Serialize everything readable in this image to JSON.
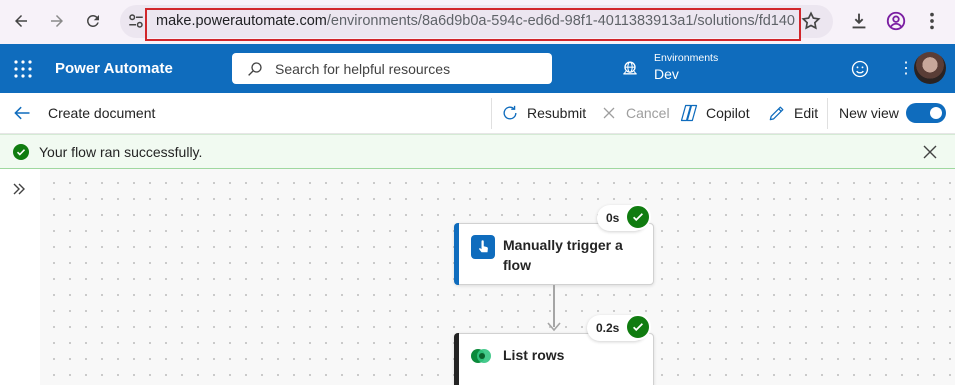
{
  "browser": {
    "url_host": "make.powerautomate.com",
    "url_path": "/environments/8a6d9b0a-594c-ed6d-98f1-4011383913a1/solutions/fd140..."
  },
  "header": {
    "app_title": "Power Automate",
    "search_placeholder": "Search for helpful resources",
    "environment_label": "Environments",
    "environment_value": "Dev",
    "overflow_glyph": "⋮"
  },
  "command_bar": {
    "flow_name": "Create document",
    "resubmit_label": "Resubmit",
    "cancel_label": "Cancel",
    "copilot_label": "Copilot",
    "edit_label": "Edit",
    "new_view_label": "New view",
    "new_view_on": true
  },
  "banner": {
    "message": "Your flow ran successfully.",
    "status": "success"
  },
  "flow": {
    "nodes": [
      {
        "title_line1": "Manually trigger a",
        "title_line2": "flow",
        "duration": "0s",
        "status": "succeeded",
        "accent_color": "#0f6cbd",
        "icon": "manual-trigger-icon"
      },
      {
        "title_line1": "List rows",
        "duration": "0.2s",
        "status": "succeeded",
        "accent_color": "#242424",
        "icon": "dataverse-icon"
      }
    ]
  },
  "colors": {
    "brand": "#0f6cbd",
    "success": "#107c10",
    "url_highlight": "#d1262b"
  }
}
